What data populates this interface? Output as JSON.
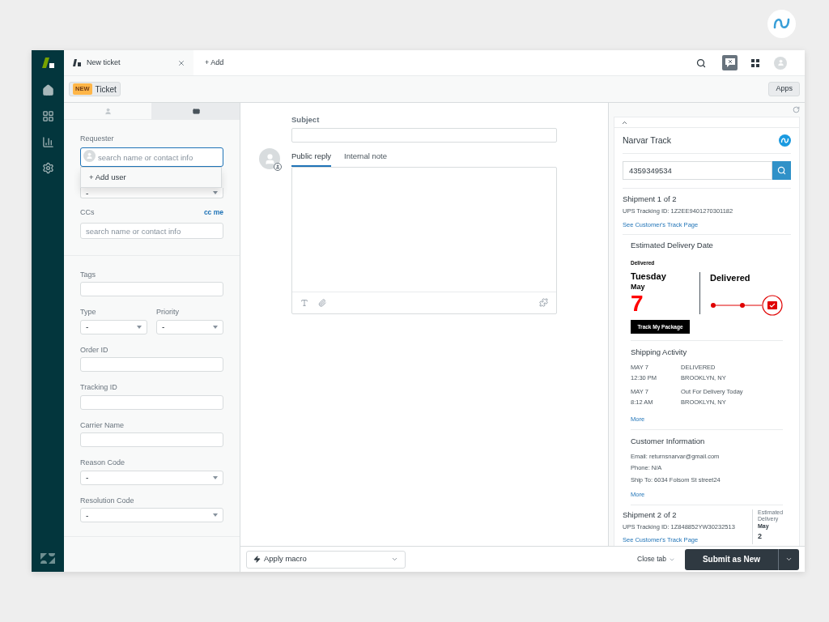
{
  "topbar": {
    "tab": {
      "label": "New ticket"
    },
    "add": "+ Add"
  },
  "subheader": {
    "badge": "NEW",
    "ticket": "Ticket",
    "apps": "Apps"
  },
  "left_panel": {
    "tabs": [
      {
        "kind": "user",
        "selected": false
      },
      {
        "kind": "ticket",
        "selected": true
      }
    ],
    "requester": {
      "label": "Requester",
      "placeholder": "search name or contact info",
      "menu": [
        "+ Add user"
      ]
    },
    "covered_select": {
      "value": "-"
    },
    "ccs": {
      "label": "CCs",
      "link": "cc me",
      "placeholder": "search name or contact info"
    },
    "fields": [
      {
        "kind": "text",
        "label": "Tags"
      },
      {
        "kind": "pair",
        "items": [
          {
            "label": "Type",
            "value": "-"
          },
          {
            "label": "Priority",
            "value": "-"
          }
        ]
      },
      {
        "kind": "text",
        "label": "Order ID"
      },
      {
        "kind": "text",
        "label": "Tracking ID"
      },
      {
        "kind": "text",
        "label": "Carrier Name"
      },
      {
        "kind": "select",
        "label": "Reason Code",
        "value": "-"
      },
      {
        "kind": "select",
        "label": "Resolution Code",
        "value": "-"
      }
    ]
  },
  "center": {
    "subject_label": "Subject",
    "reply_tabs": [
      {
        "label": "Public reply",
        "selected": true
      },
      {
        "label": "Internal note",
        "selected": false
      }
    ]
  },
  "narvar": {
    "title": "Narvar Track",
    "search_value": "4359349534",
    "shipment": {
      "title": "Shipment 1 of 2",
      "tracking": "UPS Tracking ID: 1Z2EE9401270301182",
      "link": "See Customer's Track Page",
      "estimate": {
        "heading": "Estimated Delivery Date",
        "small_status": "Delivered",
        "day": "Tuesday",
        "month": "May",
        "date": "7",
        "status": "Delivered",
        "button": "Track My Package"
      },
      "activity": {
        "heading": "Shipping Activity",
        "events": [
          {
            "date": "MAY 7",
            "time": "12:30 PM",
            "status": "DELIVERED",
            "location": "BROOKLYN, NY"
          },
          {
            "date": "MAY 7",
            "time": "8:12 AM",
            "status": "Out For Delivery Today",
            "location": "BROOKLYN, NY"
          }
        ],
        "more": "More"
      },
      "customer": {
        "heading": "Customer Information",
        "lines": [
          "Email: returnsnarvar@gmail.com",
          "Phone: N/A",
          "Ship To: 6034 Folsom St street24"
        ],
        "more": "More"
      }
    },
    "shipment_2": {
      "title": "Shipment 2 of 2",
      "tracking": "UPS Tracking ID: 1Z848852YW30232513",
      "link": "See Customer's Track Page",
      "estimate_label": "Estimated Delivery",
      "month": "May",
      "date": "2"
    }
  },
  "footer": {
    "macro": "Apply macro",
    "close_tab": "Close tab",
    "submit": "Submit as New"
  }
}
